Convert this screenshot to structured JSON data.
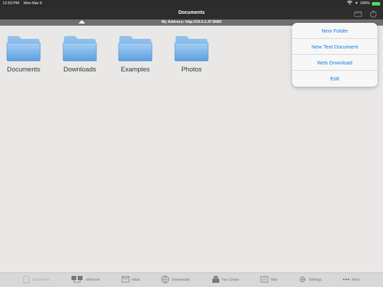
{
  "status_bar": {
    "time": "12:53 PM",
    "date": "Mon Mar 9",
    "battery": "100%"
  },
  "nav": {
    "title": "Documents"
  },
  "address": {
    "text": "My Address: http://10.0.1.47:8080"
  },
  "folders": [
    {
      "label": "Documents"
    },
    {
      "label": "Downloads"
    },
    {
      "label": "Examples"
    },
    {
      "label": "Photos"
    }
  ],
  "menu": {
    "items": [
      {
        "label": "New Folder"
      },
      {
        "label": "New Text Document"
      },
      {
        "label": "Web Download"
      },
      {
        "label": "Edit"
      }
    ]
  },
  "tabs": [
    {
      "label": "Documents",
      "icon": "documents-icon"
    },
    {
      "label": "nRemote",
      "icon": "network-icon"
    },
    {
      "label": "eMail",
      "icon": "email-icon"
    },
    {
      "label": "Downloader",
      "icon": "globe-icon"
    },
    {
      "label": "Fax Center",
      "icon": "fax-icon"
    },
    {
      "label": "Mail",
      "icon": "mail-icon"
    },
    {
      "label": "Settings",
      "icon": "gear-icon"
    },
    {
      "label": "More",
      "icon": "more-icon"
    }
  ],
  "colors": {
    "accent": "#1a7ae0",
    "folder_top": "#a6cff3",
    "folder_bottom": "#5c9ee0",
    "battery": "#4cd964"
  }
}
